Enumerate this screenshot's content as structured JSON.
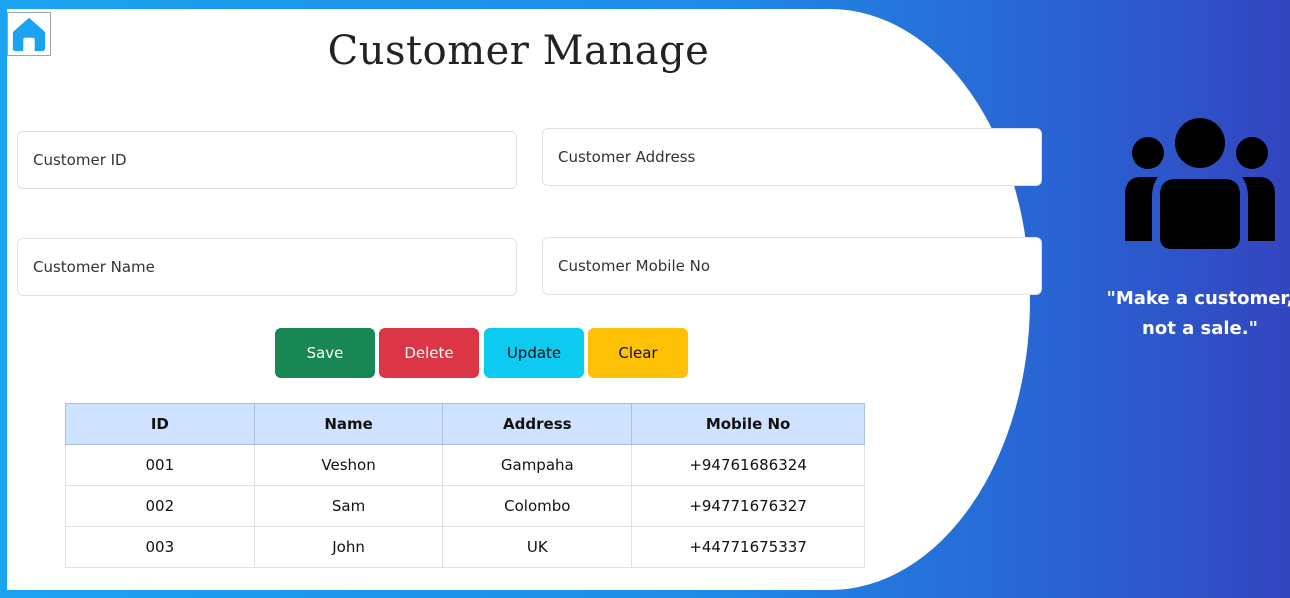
{
  "colors": {
    "accent_blue": "#1ba3f0",
    "gradient_end": "#3345c0",
    "save": "#198754",
    "delete": "#dc3545",
    "update": "#0dcaf0",
    "clear": "#ffc107",
    "table_header": "#cfe2ff"
  },
  "header": {
    "home_icon": "house-icon",
    "title": "Customer Manage"
  },
  "form": {
    "customer_id_placeholder": "Customer ID",
    "customer_address_placeholder": "Customer Address",
    "customer_name_placeholder": "Customer Name",
    "customer_mobile_placeholder": "Customer Mobile No"
  },
  "actions": {
    "save_label": "Save",
    "delete_label": "Delete",
    "update_label": "Update",
    "clear_label": "Clear"
  },
  "table": {
    "headers": [
      "ID",
      "Name",
      "Address",
      "Mobile No"
    ],
    "rows": [
      [
        "001",
        "Veshon",
        "Gampaha",
        "+94761686324"
      ],
      [
        "002",
        "Sam",
        "Colombo",
        "+94771676327"
      ],
      [
        "003",
        "John",
        "UK",
        "+44771675337"
      ]
    ]
  },
  "sidebar": {
    "icon": "users-group-icon",
    "quote_line1": "\"Make a customer,",
    "quote_line2": "not a sale.\""
  }
}
